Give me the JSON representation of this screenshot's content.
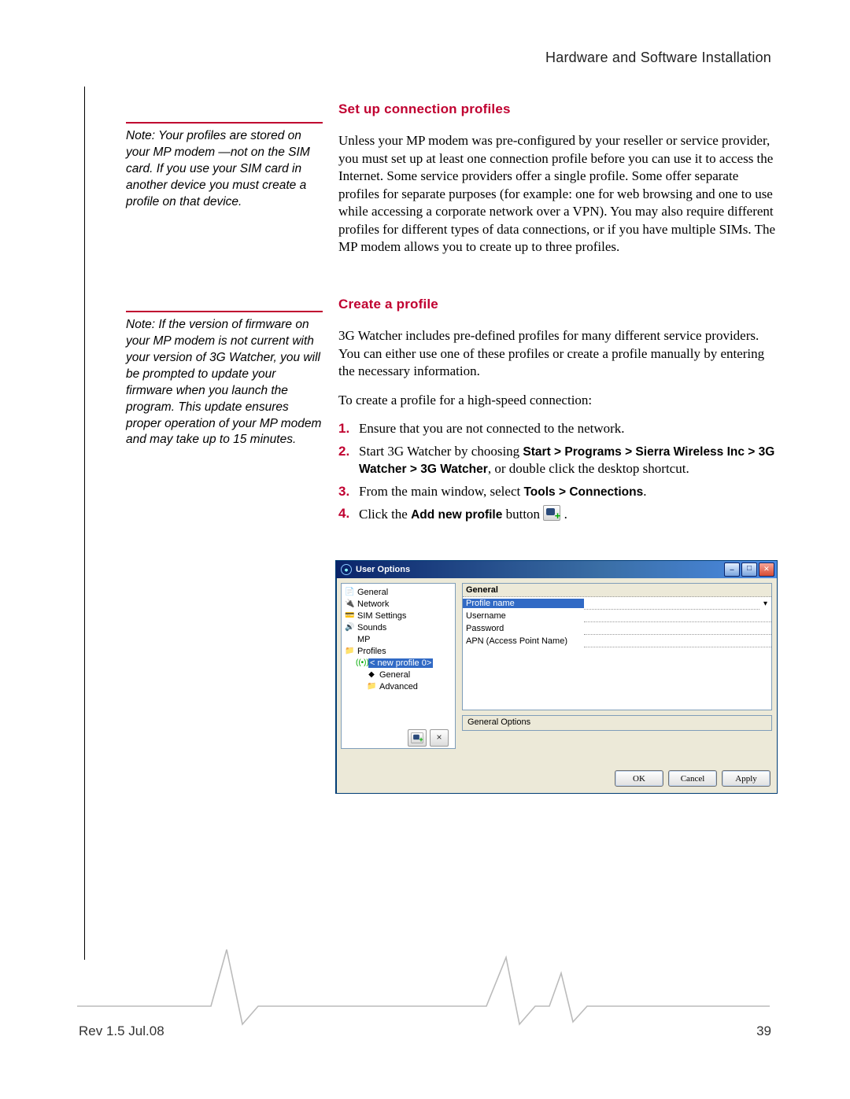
{
  "header": {
    "title": "Hardware and Software Installation"
  },
  "sidebar": {
    "note1": "Note: Your profiles are stored on your MP modem —not on the SIM card. If you use your SIM card in another device you must create a profile on that device.",
    "note2": "Note: If the version of firmware on your MP modem is not current with your version of 3G Watcher, you will be prompted to update your firmware when you launch the program. This update ensures proper operation of your MP modem and may take up to 15 minutes."
  },
  "section1": {
    "heading": "Set up connection profiles",
    "p1": "Unless your MP modem was pre-configured by your reseller or service provider, you must set up at least one connection profile before you can use it to access the Internet. Some service providers offer a single profile. Some offer separate profiles for separate purposes (for example: one for web browsing and one to use while accessing a corporate network over a VPN). You may also require different profiles for different types of data connections, or if you have multiple SIMs. The MP modem allows you to create up to three profiles."
  },
  "section2": {
    "heading": "Create a profile",
    "p1": "3G Watcher includes pre-defined profiles for many different service providers. You can either use one of these profiles or create a profile manually by entering the necessary information.",
    "p2": "To create a profile for a high-speed connection:",
    "step1": "Ensure that you are not connected to the network.",
    "step2a": "Start 3G Watcher by choosing ",
    "step2b": "Start > Programs > Sierra Wireless Inc > 3G Watcher > 3G Watcher",
    "step2c": ", or double click the desktop shortcut.",
    "step3a": "From the main window, select ",
    "step3b": "Tools > Connections",
    "step3c": ".",
    "step4a": "Click the ",
    "step4b": "Add new profile",
    "step4c": " button "
  },
  "dialog": {
    "title": "User Options",
    "tree": {
      "general": "General",
      "network": "Network",
      "sim": "SIM Settings",
      "sounds": "Sounds",
      "mp": "MP",
      "profiles": "Profiles",
      "newprofile": "< new profile 0>",
      "pgeneral": "General",
      "padvanced": "Advanced"
    },
    "panel": {
      "groupHeader": "General",
      "profile_name": "Profile name",
      "username": "Username",
      "password": "Password",
      "apn": "APN (Access Point Name)"
    },
    "status": "General Options",
    "buttons": {
      "ok": "OK",
      "cancel": "Cancel",
      "apply": "Apply"
    }
  },
  "footer": {
    "rev": "Rev 1.5  Jul.08",
    "page": "39"
  }
}
